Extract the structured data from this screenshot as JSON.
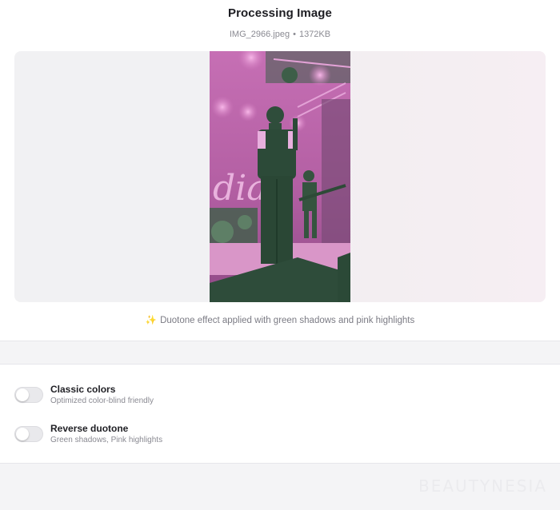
{
  "header": {
    "title": "Processing Image",
    "file_name": "IMG_2966.jpeg",
    "separator": "•",
    "file_size": "1372KB"
  },
  "preview": {
    "image_alt": "Duotone concert photo",
    "caption_icon": "✨",
    "caption": "Duotone effect applied with green shadows and pink highlights",
    "duotone_colors": {
      "shadow": "#2f5b44",
      "highlight": "#e58fd0"
    }
  },
  "options": [
    {
      "title": "Classic colors",
      "description": "Optimized color-blind friendly",
      "enabled": false
    },
    {
      "title": "Reverse duotone",
      "description": "Green shadows, Pink highlights",
      "enabled": false
    }
  ],
  "watermark": "BEAUTYNESIA"
}
